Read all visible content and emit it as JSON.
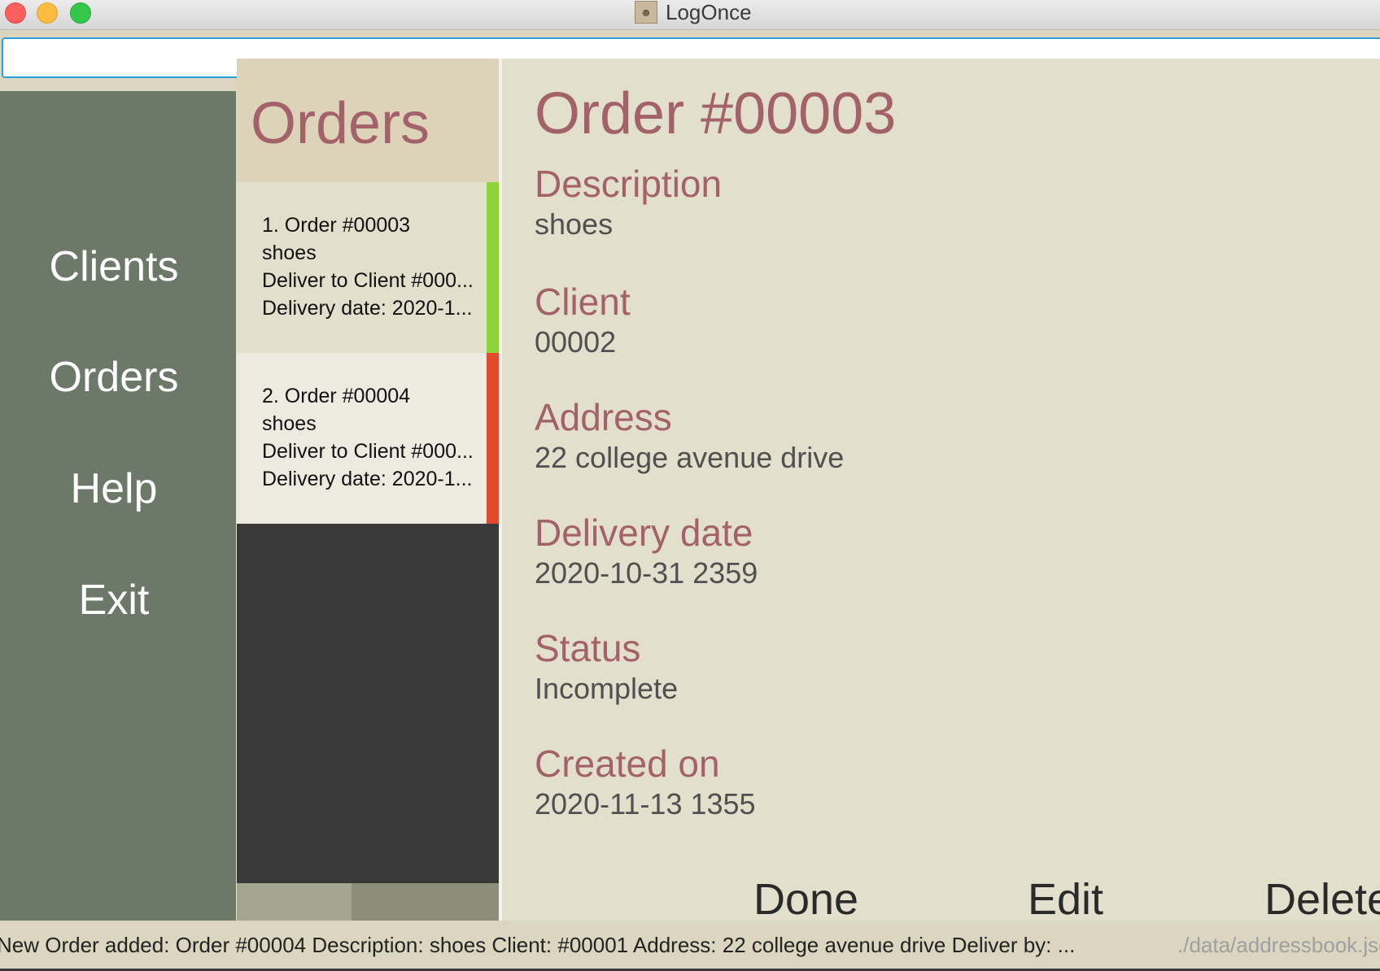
{
  "window": {
    "title": "LogOnce"
  },
  "command_box": {
    "value": ""
  },
  "sidebar": {
    "items": [
      {
        "label": "Clients"
      },
      {
        "label": "Orders"
      },
      {
        "label": "Help"
      },
      {
        "label": "Exit"
      }
    ]
  },
  "orders_list": {
    "title": "Orders",
    "cards": [
      {
        "heading": "1.  Order #00003",
        "description": "shoes",
        "deliver_to": "Deliver to Client #000...",
        "delivery_date": "Delivery date: 2020-1...",
        "status_color": "#8cd43a"
      },
      {
        "heading": "2.  Order #00004",
        "description": "shoes",
        "deliver_to": "Deliver to Client #000...",
        "delivery_date": "Delivery date: 2020-1...",
        "status_color": "#e24a2c"
      }
    ]
  },
  "details": {
    "title": "Order #00003",
    "fields": [
      {
        "label": "Description",
        "value": "shoes"
      },
      {
        "label": "Client",
        "value": "00002"
      },
      {
        "label": "Address",
        "value": "22 college avenue drive"
      },
      {
        "label": "Delivery date",
        "value": "2020-10-31 2359"
      },
      {
        "label": "Status",
        "value": "Incomplete"
      },
      {
        "label": "Created on",
        "value": "2020-11-13 1355"
      }
    ],
    "actions": {
      "done": "Done",
      "edit": "Edit",
      "delete": "Delete"
    }
  },
  "status_bar": {
    "message": "New Order added: Order #00004  Description: shoes Client: #00001 Address: 22 college avenue drive Deliver by: ...",
    "path": "./data/addressbook.json"
  },
  "colors": {
    "accent": "#a3626a",
    "sidebar": "#6c7868",
    "panel_bg": "#e3dfcd",
    "list_bg": "#393939"
  }
}
